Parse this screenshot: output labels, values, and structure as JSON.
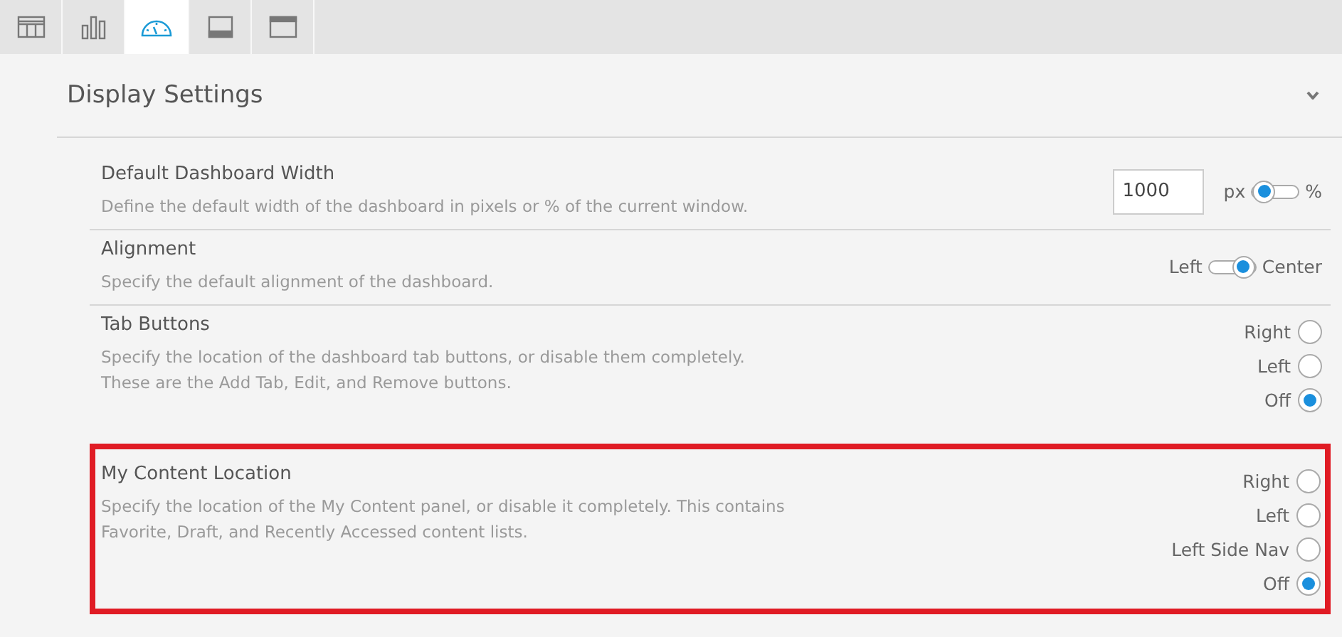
{
  "tabs": [
    {
      "selected": false
    },
    {
      "selected": false
    },
    {
      "selected": true
    },
    {
      "selected": false
    },
    {
      "selected": false
    }
  ],
  "panel": {
    "title": "Display Settings",
    "expanded": true
  },
  "settings": [
    {
      "kind": "width",
      "title": "Default Dashboard Width",
      "description": [
        "Define the default width of the dashboard in pixels or % of the current window."
      ],
      "highlighted": false,
      "value": "1000",
      "switch": {
        "left": "px",
        "right": "%",
        "right_on": false
      }
    },
    {
      "kind": "switch",
      "title": "Alignment",
      "description": [
        "Specify the default alignment of the dashboard."
      ],
      "highlighted": false,
      "switch": {
        "left": "Left",
        "right": "Center",
        "right_on": true
      }
    },
    {
      "kind": "radios",
      "title": "Tab Buttons",
      "description": [
        "Specify the location of the dashboard tab buttons, or disable them completely.",
        "These are the Add Tab, Edit, and Remove buttons."
      ],
      "highlighted": false,
      "options": [
        {
          "label": "Right",
          "selected": false
        },
        {
          "label": "Left",
          "selected": false
        },
        {
          "label": "Off",
          "selected": true
        }
      ]
    },
    {
      "kind": "radios",
      "title": "My Content Location",
      "description": [
        "Specify the location of the My Content panel, or disable it completely. This contains",
        "Favorite, Draft, and Recently Accessed content lists."
      ],
      "highlighted": true,
      "options": [
        {
          "label": "Right",
          "selected": false
        },
        {
          "label": "Left",
          "selected": false
        },
        {
          "label": "Left Side Nav",
          "selected": false
        },
        {
          "label": "Off",
          "selected": true
        }
      ]
    }
  ]
}
